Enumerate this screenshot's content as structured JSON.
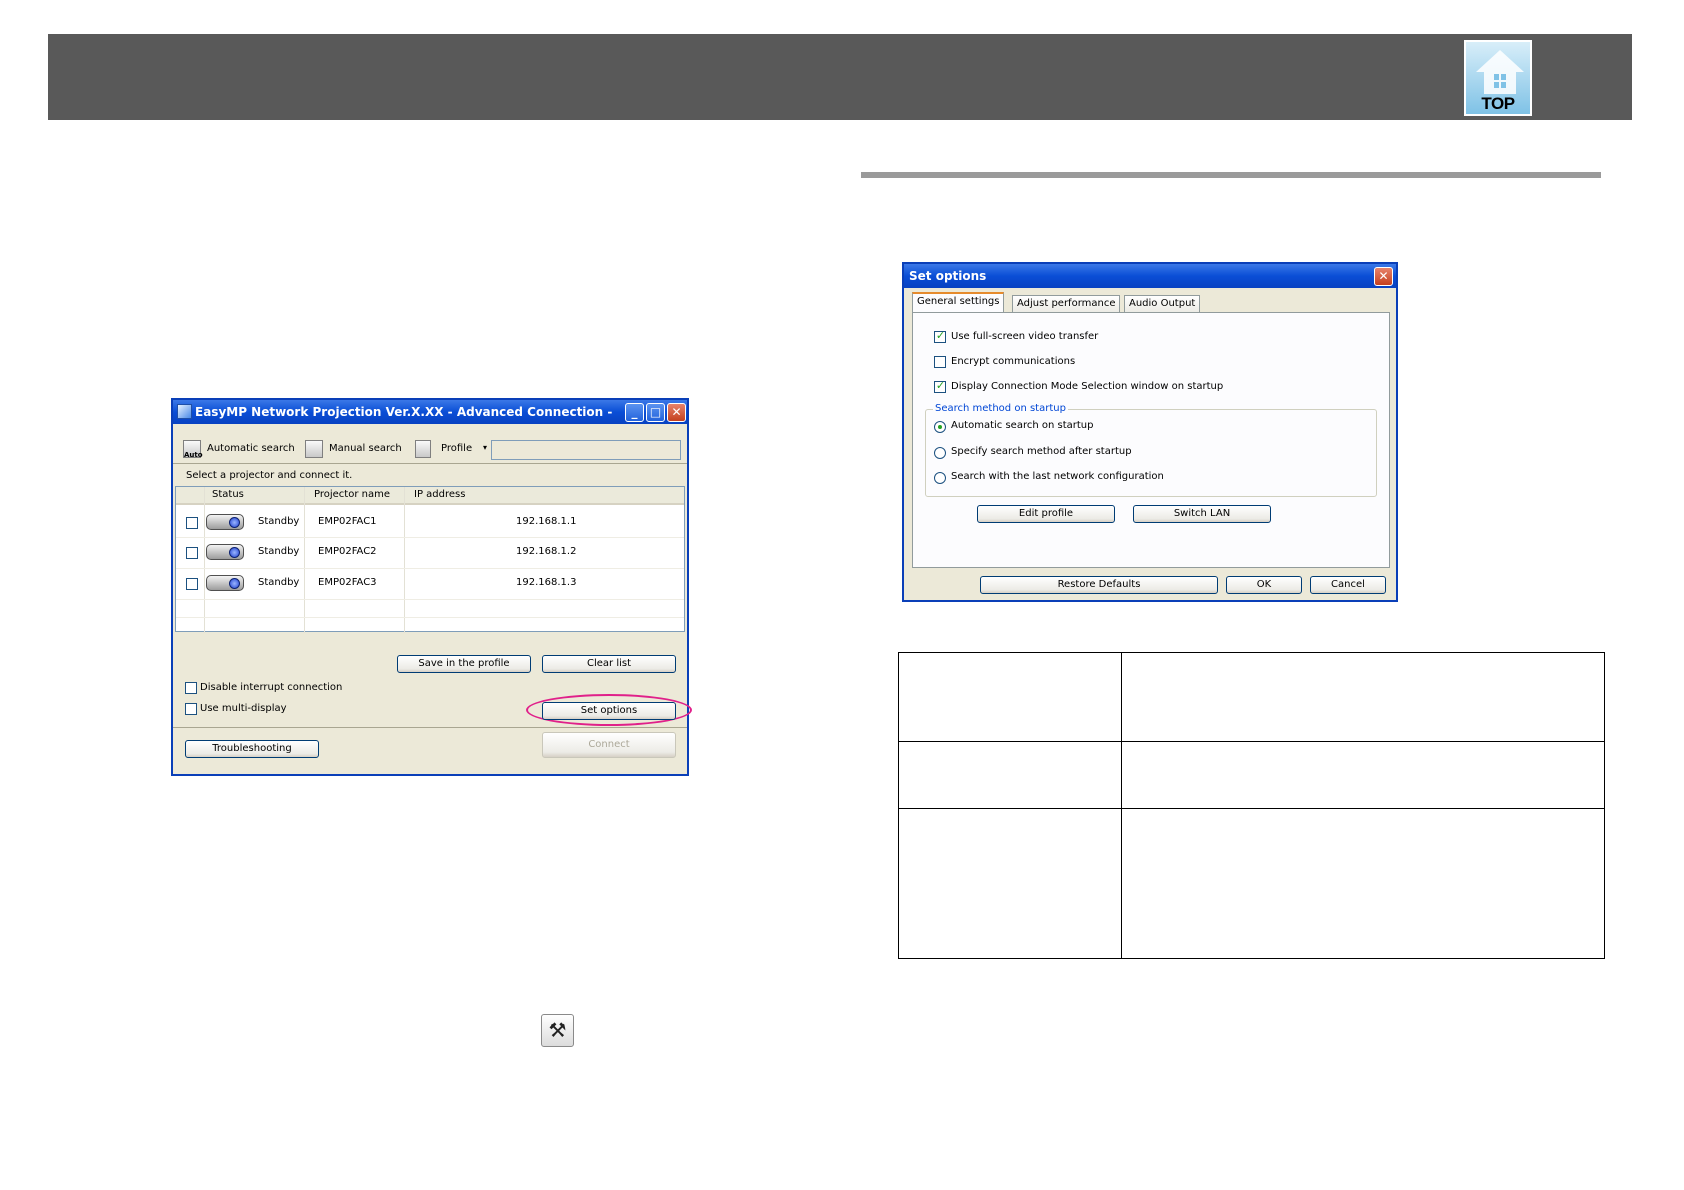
{
  "header": {
    "logo_text": "TOP"
  },
  "easymp_window": {
    "title": "EasyMP Network Projection Ver.X.XX - Advanced Connection -",
    "toolbar": {
      "auto_caption": "Auto",
      "automatic_search": "Automatic search",
      "manual_search": "Manual search",
      "profile": "Profile",
      "profile_dropdown": "▾"
    },
    "instruction": "Select a projector and connect it.",
    "columns": [
      "Status",
      "Projector name",
      "IP address"
    ],
    "rows": [
      {
        "status": "Standby",
        "name": "EMP02FAC1",
        "ip": "192.168.1.1"
      },
      {
        "status": "Standby",
        "name": "EMP02FAC2",
        "ip": "192.168.1.2"
      },
      {
        "status": "Standby",
        "name": "EMP02FAC3",
        "ip": "192.168.1.3"
      }
    ],
    "buttons": {
      "save_in_profile": "Save in the profile",
      "clear_list": "Clear list",
      "set_options": "Set options",
      "troubleshooting": "Troubleshooting",
      "connect": "Connect"
    },
    "options": {
      "disable_interrupt": "Disable interrupt connection",
      "use_multi_display": "Use multi-display"
    }
  },
  "set_options_window": {
    "title": "Set options",
    "tabs": [
      "General settings",
      "Adjust performance",
      "Audio Output"
    ],
    "checkboxes": [
      {
        "label": "Use full-screen video transfer",
        "checked": true
      },
      {
        "label": "Encrypt communications",
        "checked": false
      },
      {
        "label": "Display Connection Mode Selection window on startup",
        "checked": true
      }
    ],
    "search_group": {
      "legend": "Search method on startup",
      "radios": [
        {
          "label": "Automatic search on startup",
          "selected": true
        },
        {
          "label": "Specify search method after startup",
          "selected": false
        },
        {
          "label": "Search with the last network configuration",
          "selected": false
        }
      ]
    },
    "buttons": {
      "edit_profile": "Edit profile",
      "switch_lan": "Switch LAN",
      "restore_defaults": "Restore Defaults",
      "ok": "OK",
      "cancel": "Cancel"
    }
  },
  "icons": {
    "checkmark": "✓",
    "minimize": "_",
    "maximize": "□",
    "close": "✕",
    "setup_tool": "⚒"
  }
}
